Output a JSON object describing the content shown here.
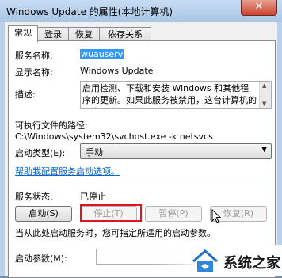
{
  "window": {
    "title": "Windows Update 的属性(本地计算机)",
    "close_label": "✕"
  },
  "tabs": [
    {
      "label": "常规",
      "active": true
    },
    {
      "label": "登录",
      "active": false
    },
    {
      "label": "恢复",
      "active": false
    },
    {
      "label": "依存关系",
      "active": false
    }
  ],
  "general": {
    "service_name_label": "服务名称:",
    "service_name_value": "wuauserv",
    "display_name_label": "显示名称:",
    "display_name_value": "Windows Update",
    "description_label": "描述:",
    "description_value": "启用检测、下载和安装 Windows 和其他程序的更新。如果此服务被禁用，这台计算机的用户",
    "path_label": "可执行文件的路径:",
    "path_value": "C:\\Windows\\system32\\svchost.exe -k netsvcs",
    "startup_type_label": "启动类型(E):",
    "startup_type_value": "手动",
    "help_link": "帮助我配置服务启动选项。",
    "status_label": "服务状态:",
    "status_value": "已停止",
    "hint_text": "当从此处启动服务时，您可指定所适用的启动参数。",
    "params_label": "启动参数(M):"
  },
  "buttons": {
    "start": "启动(S)",
    "stop": "停止(T)",
    "pause": "暂停(P)",
    "resume": "恢复(R)"
  },
  "watermark": {
    "text": "系统之家"
  },
  "colors": {
    "selection": "#3399ff",
    "highlight_box": "#e0141e",
    "link": "#0066cc"
  }
}
